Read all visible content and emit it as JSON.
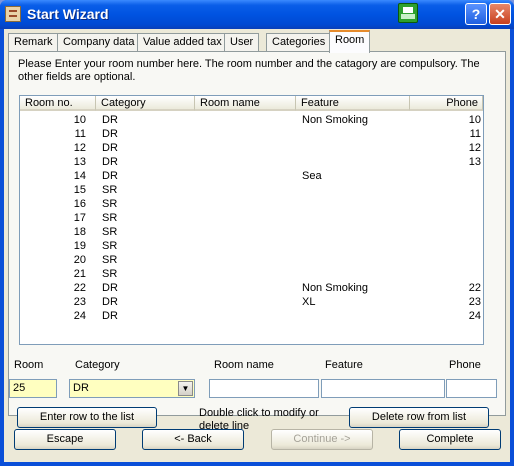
{
  "window": {
    "title": "Start Wizard"
  },
  "tabs": [
    {
      "label": "Remark"
    },
    {
      "label": "Company data"
    },
    {
      "label": "Value added tax"
    },
    {
      "label": "User"
    },
    {
      "label": "Categories"
    },
    {
      "label": "Room"
    }
  ],
  "active_tab": "Room",
  "instructions": "Please Enter your room number here. The room number and the catagory are compulsory. The other fields are optional.",
  "table": {
    "columns": [
      "Room no.",
      "Category",
      "Room name",
      "Feature",
      "Phone"
    ],
    "rows": [
      [
        "10",
        "DR",
        "",
        "Non Smoking",
        "10"
      ],
      [
        "11",
        "DR",
        "",
        "",
        "11"
      ],
      [
        "12",
        "DR",
        "",
        "",
        "12"
      ],
      [
        "13",
        "DR",
        "",
        "",
        "13"
      ],
      [
        "14",
        "DR",
        "",
        "Sea",
        ""
      ],
      [
        "15",
        "SR",
        "",
        "",
        ""
      ],
      [
        "16",
        "SR",
        "",
        "",
        ""
      ],
      [
        "17",
        "SR",
        "",
        "",
        ""
      ],
      [
        "18",
        "SR",
        "",
        "",
        ""
      ],
      [
        "19",
        "SR",
        "",
        "",
        ""
      ],
      [
        "20",
        "SR",
        "",
        "",
        ""
      ],
      [
        "21",
        "SR",
        "",
        "",
        ""
      ],
      [
        "22",
        "DR",
        "",
        "Non Smoking",
        "22"
      ],
      [
        "23",
        "DR",
        "",
        "XL",
        "23"
      ],
      [
        "24",
        "DR",
        "",
        "",
        "24"
      ]
    ]
  },
  "form": {
    "room_label": "Room",
    "room_value": "25",
    "category_label": "Category",
    "category_value": "DR",
    "room_name_label": "Room name",
    "room_name_value": "",
    "feature_label": "Feature",
    "feature_value": "",
    "phone_label": "Phone",
    "phone_value": ""
  },
  "buttons": {
    "enter_row": "Enter row to the list",
    "hint": "Double click to modify or delete line",
    "delete_row": "Delete row from list",
    "escape": "Escape",
    "back": "<- Back",
    "continue": "Continue ->",
    "complete": "Complete"
  },
  "icons": [
    "app-icon",
    "printer-icon",
    "help-icon",
    "close-icon",
    "dropdown-arrow-icon"
  ],
  "colors": {
    "titlebar": "#0053e1",
    "active_tab_accent": "#e68b2c",
    "required_field": "#ffffc0"
  }
}
